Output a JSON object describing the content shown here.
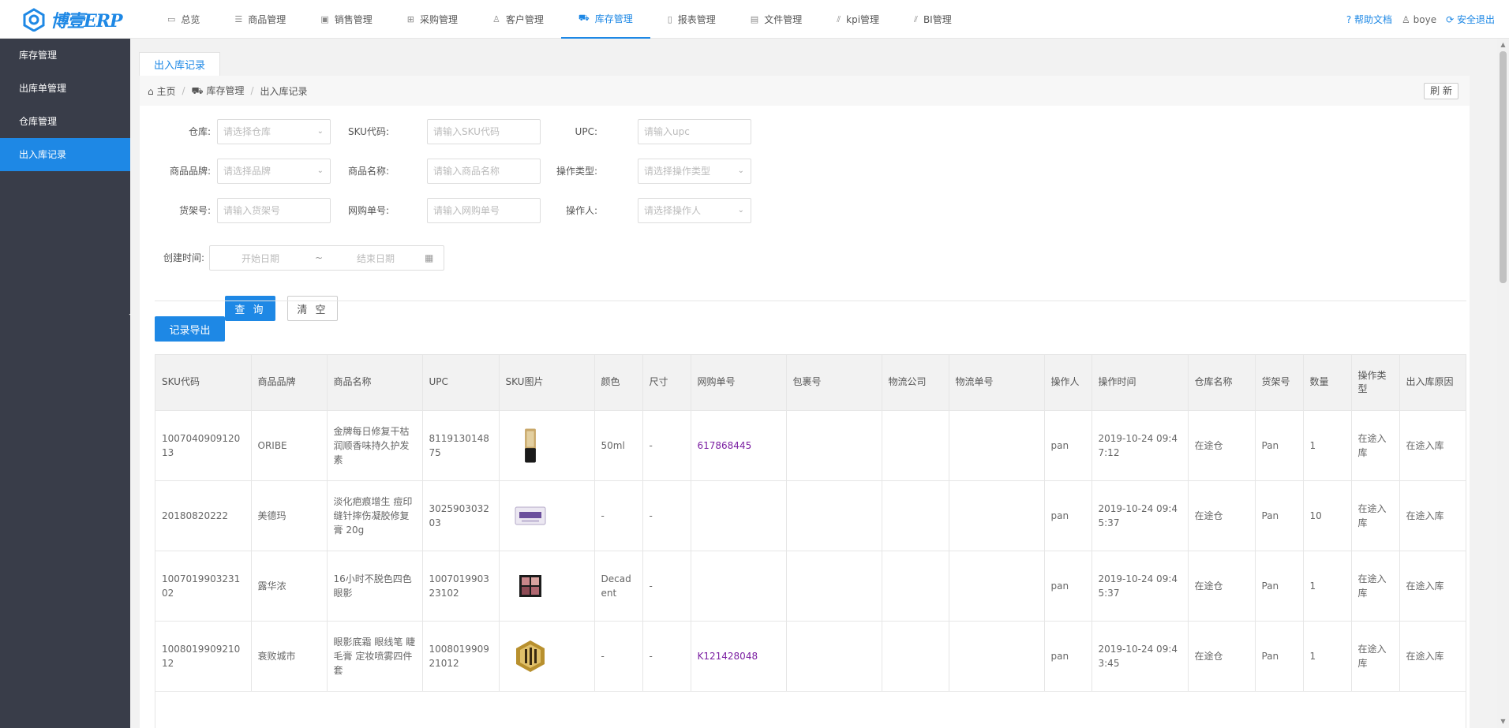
{
  "app": {
    "logo_text": "博壹ERP"
  },
  "nav": {
    "items": [
      {
        "label": "总览",
        "icon": "monitor-icon"
      },
      {
        "label": "商品管理",
        "icon": "list-icon"
      },
      {
        "label": "销售管理",
        "icon": "save-icon"
      },
      {
        "label": "采购管理",
        "icon": "grid-icon"
      },
      {
        "label": "客户管理",
        "icon": "user-icon"
      },
      {
        "label": "库存管理",
        "icon": "cart-icon",
        "active": true
      },
      {
        "label": "报表管理",
        "icon": "file-icon"
      },
      {
        "label": "文件管理",
        "icon": "document-icon"
      },
      {
        "label": "kpi管理",
        "icon": "chart-icon"
      },
      {
        "label": "BI管理",
        "icon": "chart-icon"
      }
    ]
  },
  "header_right": {
    "help": "帮助文档",
    "user": "boye",
    "logout": "安全退出"
  },
  "sidebar": {
    "items": [
      {
        "label": "库存管理"
      },
      {
        "label": "出库单管理"
      },
      {
        "label": "仓库管理"
      },
      {
        "label": "出入库记录",
        "active": true
      }
    ]
  },
  "tab": {
    "label": "出入库记录"
  },
  "breadcrumb": {
    "home": "主页",
    "parent": "库存管理",
    "current": "出入库记录",
    "sep": "/"
  },
  "refresh_label": "刷 新",
  "form": {
    "warehouse": {
      "label": "仓库:",
      "placeholder": "请选择仓库"
    },
    "sku": {
      "label": "SKU代码:",
      "placeholder": "请输入SKU代码"
    },
    "upc": {
      "label": "UPC:",
      "placeholder": "请输入upc"
    },
    "brand": {
      "label": "商品品牌:",
      "placeholder": "请选择品牌"
    },
    "name": {
      "label": "商品名称:",
      "placeholder": "请输入商品名称"
    },
    "op_type": {
      "label": "操作类型:",
      "placeholder": "请选择操作类型"
    },
    "shelf": {
      "label": "货架号:",
      "placeholder": "请输入货架号"
    },
    "order": {
      "label": "网购单号:",
      "placeholder": "请输入网购单号"
    },
    "operator": {
      "label": "操作人:",
      "placeholder": "请选择操作人"
    },
    "created": {
      "label": "创建时间:",
      "start": "开始日期",
      "end": "结束日期",
      "tilde": "~"
    },
    "query_label": "查 询",
    "clear_label": "清 空"
  },
  "export_label": "记录导出",
  "table": {
    "headers": [
      "SKU代码",
      "商品品牌",
      "商品名称",
      "UPC",
      "SKU图片",
      "颜色",
      "尺寸",
      "网购单号",
      "包裹号",
      "物流公司",
      "物流单号",
      "操作人",
      "操作时间",
      "仓库名称",
      "货架号",
      "数量",
      "操作类型",
      "出入库原因"
    ],
    "rows": [
      {
        "sku": "100704090912013",
        "brand": "ORIBE",
        "name": "金牌每日修复干枯润顺香味持久护发素",
        "upc": "811913014875",
        "image": "tube-bottle",
        "color": "50ml",
        "size": "-",
        "order": "617868445",
        "package": "",
        "carrier": "",
        "tracking": "",
        "operator": "pan",
        "time": "2019-10-24 09:47:12",
        "warehouse": "在途仓",
        "shelf": "Pan",
        "qty": "1",
        "op_type": "在途入库",
        "reason": "在途入库"
      },
      {
        "sku": "20180820222",
        "brand": "美德玛",
        "name": "淡化疤痕增生 痘印缝针摔伤凝胶修复膏 20g",
        "upc": "302590303203",
        "image": "cream-box",
        "color": "-",
        "size": "-",
        "order": "",
        "package": "",
        "carrier": "",
        "tracking": "",
        "operator": "pan",
        "time": "2019-10-24 09:45:37",
        "warehouse": "在途仓",
        "shelf": "Pan",
        "qty": "10",
        "op_type": "在途入库",
        "reason": "在途入库"
      },
      {
        "sku": "100701990323102",
        "brand": "露华浓",
        "name": "16小时不脱色四色眼影",
        "upc": "100701990323102",
        "image": "eyeshadow-palette",
        "color": "Decadent",
        "size": "-",
        "order": "",
        "package": "",
        "carrier": "",
        "tracking": "",
        "operator": "pan",
        "time": "2019-10-24 09:45:37",
        "warehouse": "在途仓",
        "shelf": "Pan",
        "qty": "1",
        "op_type": "在途入库",
        "reason": "在途入库"
      },
      {
        "sku": "100801990921012",
        "brand": "衰败城市",
        "name": "眼影底霜 眼线笔 睫毛膏 定妆喷雾四件套",
        "upc": "100801990921012",
        "image": "gold-set",
        "color": "-",
        "size": "-",
        "order": "K121428048",
        "package": "",
        "carrier": "",
        "tracking": "",
        "operator": "pan",
        "time": "2019-10-24 09:43:45",
        "warehouse": "在途仓",
        "shelf": "Pan",
        "qty": "1",
        "op_type": "在途入库",
        "reason": "在途入库"
      }
    ]
  },
  "colors": {
    "accent": "#1e88e5",
    "sidebar_bg": "#393d49",
    "link": "#7b1fa2"
  }
}
